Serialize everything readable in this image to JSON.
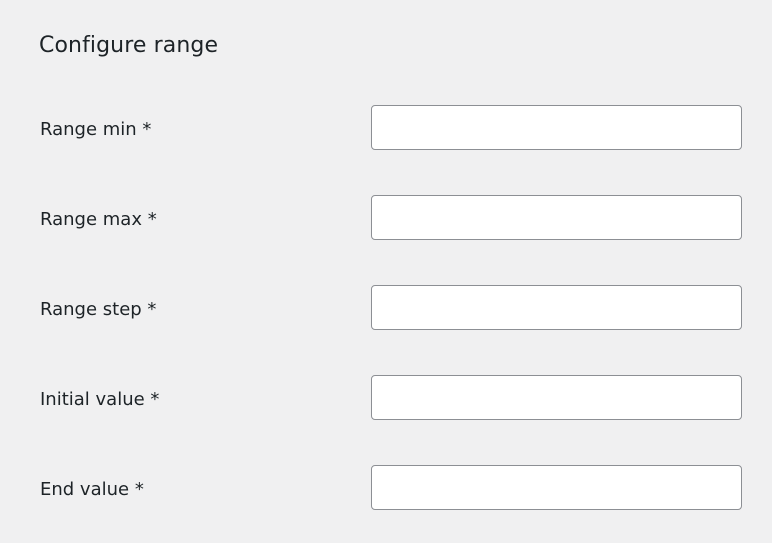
{
  "form": {
    "title": "Configure range",
    "fields": [
      {
        "label": "Range min *",
        "value": "",
        "placeholder": ""
      },
      {
        "label": "Range max *",
        "value": "",
        "placeholder": ""
      },
      {
        "label": "Range step *",
        "value": "",
        "placeholder": ""
      },
      {
        "label": "Initial value *",
        "value": "",
        "placeholder": ""
      },
      {
        "label": "End value *",
        "value": "",
        "placeholder": ""
      }
    ]
  },
  "colors": {
    "background": "#f0f0f1",
    "input_border": "#8c8f94",
    "input_background": "#ffffff",
    "text": "#1d2327"
  }
}
